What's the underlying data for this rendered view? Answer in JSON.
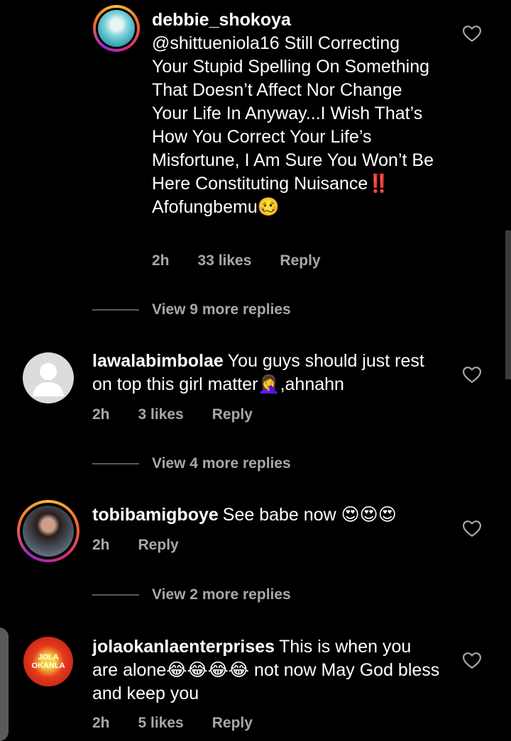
{
  "comments": [
    {
      "username": "debbie_shokoya",
      "text": "@shittueniola16 Still Correcting Your Stupid Spelling On Something That Doesn’t Affect Nor Change Your Life In Anyway...I Wish That’s How You Correct Your Life’s Misfortune, I Am Sure You Won’t Be Here Constituting Nuisance‼️ Afofungbemu🥴",
      "time": "2h",
      "likes": "33 likes",
      "reply": "Reply",
      "view_more": "View 9 more replies"
    },
    {
      "username": "lawalabimbolae",
      "text": "You guys should just rest on top this girl matter🤦‍♀️,ahnahn",
      "time": "2h",
      "likes": "3 likes",
      "reply": "Reply",
      "view_more": "View 4 more replies"
    },
    {
      "username": "tobibamigboye",
      "text": "See babe now 😍😍😍",
      "time": "2h",
      "reply": "Reply",
      "view_more": "View 2 more replies"
    },
    {
      "username": "jolaokanlaenterprises",
      "text": "This is when you are alone😂😂😂😂 not now May God bless and keep you",
      "time": "2h",
      "likes": "5 likes",
      "reply": "Reply",
      "avatar_text": "JOLA OKANLA"
    }
  ],
  "colors": {
    "background": "#000000",
    "meta": "#a8a8a8",
    "text": "#ffffff"
  }
}
